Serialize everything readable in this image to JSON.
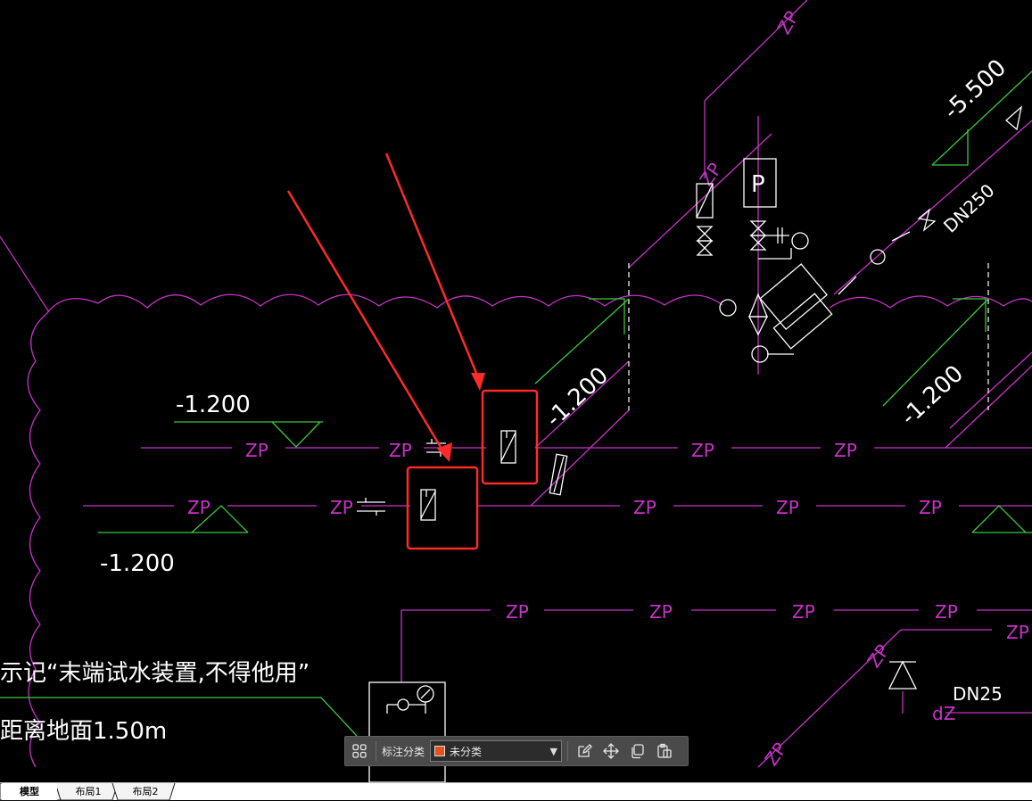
{
  "drawing": {
    "elevations": [
      "-1.200",
      "-1.200",
      "-1.200",
      "-1.200",
      "-5.500"
    ],
    "pipe_label": "ZP",
    "dn_labels": [
      "DN250",
      "DN25"
    ],
    "dz_label": "dZ",
    "pump_label": "P",
    "note_line1": "示记“末端试水装置,不得他用”",
    "note_line2": "距离地面1.50m",
    "colors": {
      "pipe": "#c832c8",
      "annot": "#3cc83c",
      "symbol": "#ffffff",
      "highlight": "#ff2a2a",
      "background": "#000000"
    }
  },
  "toolbar": {
    "label": "标注分类",
    "select_value": "未分类",
    "select_color": "#e8501e",
    "icons": [
      "grid-icon",
      "edit-icon",
      "move-icon",
      "copy-icon",
      "paste-icon"
    ]
  },
  "tabs": [
    "模型",
    "布局1",
    "布局2"
  ],
  "active_tab": "模型"
}
